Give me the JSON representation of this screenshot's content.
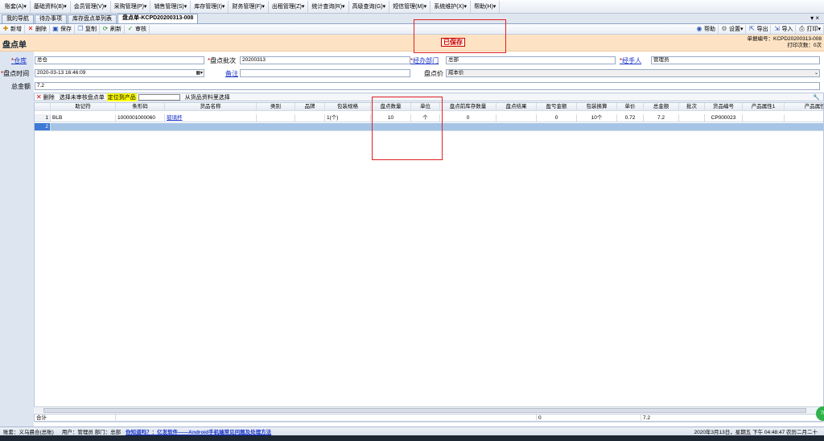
{
  "menu": [
    "账套(A)▾",
    "基础资料(B)▾",
    "会员管理(V)▾",
    "采购管理(P)▾",
    "销售管理(S)▾",
    "库存管理(I)▾",
    "财务管理(F)▾",
    "出租管理(Z)▾",
    "统计查询(R)▾",
    "高级查询(G)▾",
    "短信管理(M)▾",
    "系统维护(X)▾",
    "帮助(H)▾"
  ],
  "tabs": [
    "我的导航",
    "待办事项",
    "库存盘点单列表",
    "盘点单-KCPD20200313-008"
  ],
  "tab_close": "▾ ×",
  "toolbar": {
    "new": "新增",
    "delete": "删除",
    "save": "保存",
    "copy": "复制",
    "refresh": "刷新",
    "audit": "审核",
    "help": "帮助",
    "settings": "设置▾",
    "export": "导出",
    "import": "导入",
    "print": "打印▾"
  },
  "header": {
    "title": "盘点单",
    "status": "已保存",
    "doc_no": "单据编号：KCPD20200313-008",
    "print_count": "打印次数：0次"
  },
  "form": {
    "warehouse_label": "仓库",
    "warehouse": "总仓",
    "batch_label": "盘点批次",
    "batch": "20200313",
    "dept_label": "经办部门",
    "dept": "总部",
    "handler_label": "经手人",
    "handler": "管理员",
    "time_label": "盘点时间",
    "time": "2020-03-13 16:46:09",
    "remark_label": "备注",
    "remark": "",
    "price_label": "盘点价",
    "price": "成本价",
    "total_label": "总金额",
    "total": "7.2"
  },
  "gridbar": {
    "delete": "删除",
    "select_unaudited": "选择未审核盘点单",
    "locate": "定位到产品",
    "from_catalog": "从货品资料里选择"
  },
  "grid": {
    "headers": [
      "助记符",
      "条形码",
      "货品名称",
      "类别",
      "品牌",
      "包装规格",
      "盘点数量",
      "单位",
      "盘点前库存数量",
      "盘点结果",
      "盈亏金额",
      "包装换算",
      "单价",
      "总金额",
      "批次",
      "货品编号",
      "产品属性1",
      "产品属性2"
    ],
    "rows": [
      [
        "BLB",
        "1000001000060",
        "玻璃杯",
        "",
        "",
        "1(个)",
        "10",
        "个",
        "0",
        "",
        "0",
        "10个",
        "0.72",
        "7.2",
        "",
        "CP000023",
        "",
        ""
      ]
    ],
    "row_numbers": [
      "1",
      "2"
    ]
  },
  "footer": {
    "label": "合计",
    "profit_total": "0",
    "amount_total": "7.2"
  },
  "statusbar": {
    "account": "账套：义乌晨合(总账)",
    "user": "用户：管理员  部门：总部",
    "news": "你知道吗？：亿发软件——Android手机端常见问题及处理方法",
    "clock": "2020年3月13日，星期五 下午 04:48:47 农历二月二十"
  },
  "bubble": "78"
}
